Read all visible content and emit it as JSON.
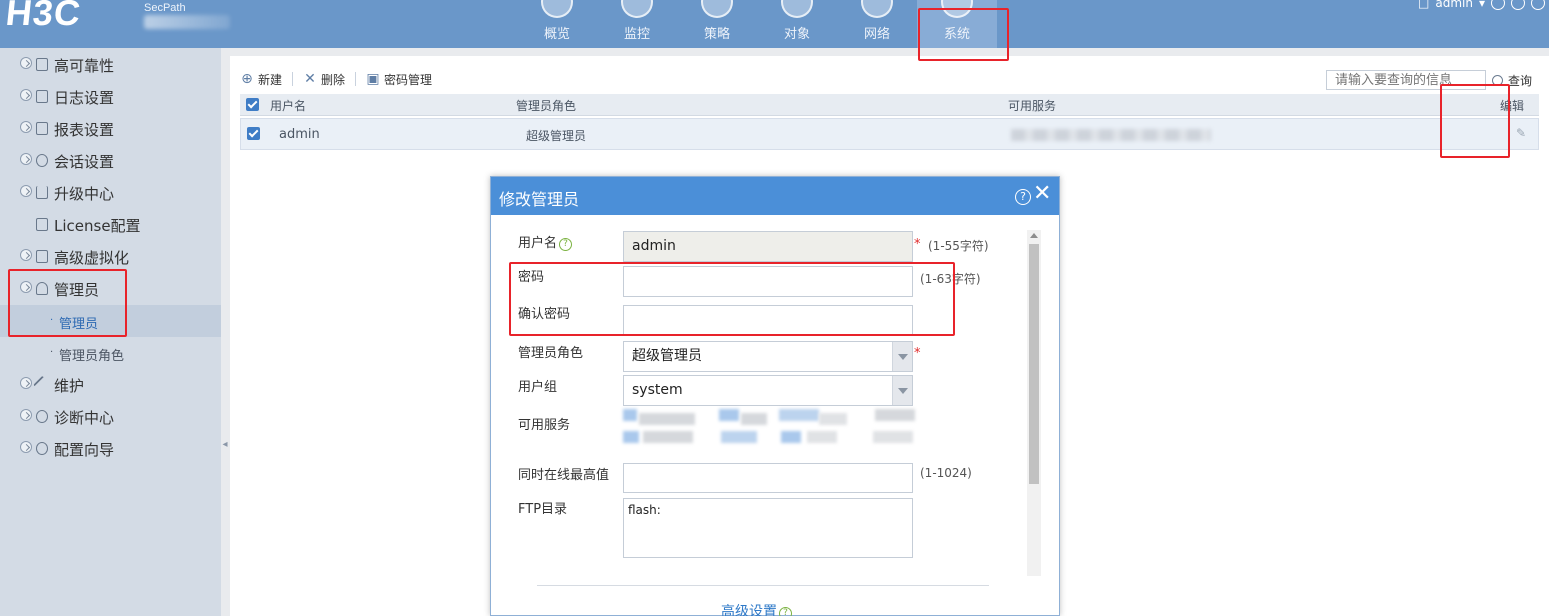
{
  "header": {
    "logo": "H3C",
    "product": "SecPath",
    "nav": [
      {
        "label": "概览",
        "icon": "overview-icon"
      },
      {
        "label": "监控",
        "icon": "monitor-icon"
      },
      {
        "label": "策略",
        "icon": "policy-shield-icon"
      },
      {
        "label": "对象",
        "icon": "object-share-icon"
      },
      {
        "label": "网络",
        "icon": "network-globe-icon"
      },
      {
        "label": "系统",
        "icon": "system-icon",
        "active": true
      }
    ],
    "user": "admin"
  },
  "sidebar": {
    "items": [
      {
        "label": "高可靠性"
      },
      {
        "label": "日志设置"
      },
      {
        "label": "报表设置"
      },
      {
        "label": "会话设置"
      },
      {
        "label": "升级中心"
      },
      {
        "label": "License配置"
      },
      {
        "label": "高级虚拟化"
      },
      {
        "label": "管理员"
      },
      {
        "label": "维护"
      },
      {
        "label": "诊断中心"
      },
      {
        "label": "配置向导"
      }
    ],
    "subitems": [
      {
        "label": "管理员",
        "active": true
      },
      {
        "label": "管理员角色"
      }
    ]
  },
  "toolbar": {
    "new_label": "新建",
    "delete_label": "删除",
    "password_label": "密码管理",
    "search_placeholder": "请输入要查询的信息",
    "search_label": "查询"
  },
  "table": {
    "columns": [
      "用户名",
      "管理员角色",
      "可用服务",
      "编辑"
    ],
    "rows": [
      {
        "username": "admin",
        "role": "超级管理员"
      }
    ]
  },
  "dialog": {
    "title": "修改管理员",
    "fields": {
      "username_label": "用户名",
      "username_value": "admin",
      "username_hint": "(1-55字符)",
      "password_label": "密码",
      "password_hint": "(1-63字符)",
      "confirm_label": "确认密码",
      "role_label": "管理员角色",
      "role_value": "超级管理员",
      "group_label": "用户组",
      "group_value": "system",
      "services_label": "可用服务",
      "max_online_label": "同时在线最高值",
      "max_online_hint": "(1-1024)",
      "ftp_label": "FTP目录",
      "ftp_value": "flash:"
    },
    "advanced_label": "高级设置"
  },
  "colors": {
    "header_bg": "#6a97c9",
    "dialog_header": "#4b8fd8",
    "annotation_red": "#e8232a",
    "accent_blue": "#3f7dc6"
  }
}
